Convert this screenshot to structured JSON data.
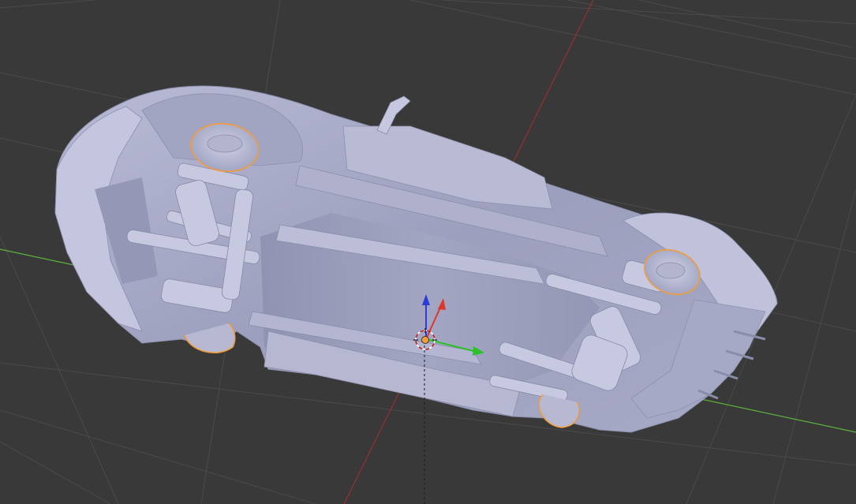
{
  "viewport": {
    "background": "#393939",
    "grid_color": "#4b4b4b",
    "x_axis_color": "#5bb43c",
    "y_axis_color": "#9a2f2f",
    "selection_outline_color": "#f39b38",
    "mesh_color": "#a9abc7"
  },
  "scene": {
    "object": "car-underside-mesh",
    "selected_parts": [
      "front-left-wheel",
      "front-right-wheel",
      "rear-left-wheel",
      "rear-right-wheel"
    ]
  },
  "gizmo": {
    "icons": [
      "3d-cursor-icon",
      "z-arrow-icon",
      "x-arrow-icon",
      "y-arrow-icon"
    ],
    "z_color": "#2c3cd6",
    "x_color": "#e0352c",
    "y_color": "#2bc12b"
  }
}
